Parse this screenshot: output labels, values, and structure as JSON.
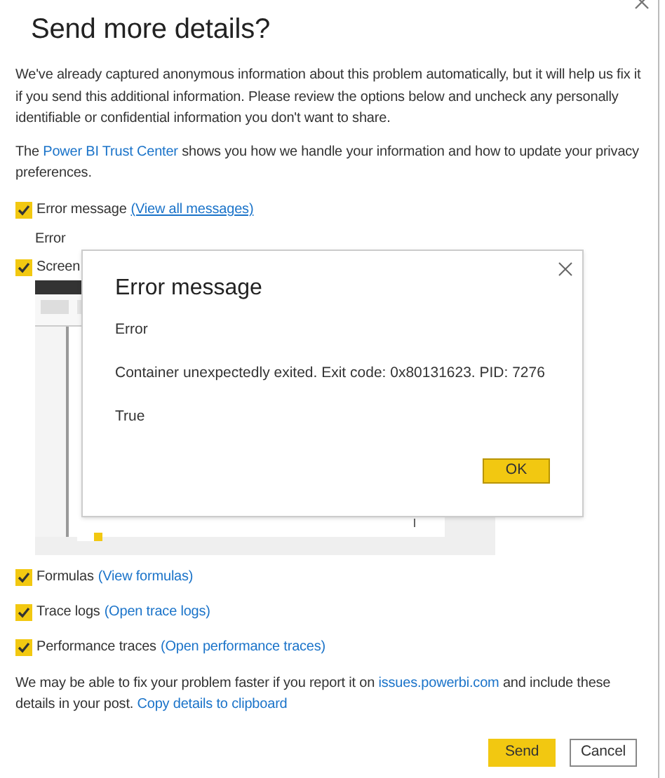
{
  "dialog": {
    "title": "Send more details?",
    "intro": "We've already captured anonymous information about this problem automatically, but it will help us fix it if you send this additional information. Please review the options below and uncheck any personally identifiable or confidential information you don't want to share.",
    "trust": {
      "before": "The ",
      "link": "Power BI Trust Center",
      "after": " shows you how we handle your information and how to update your privacy preferences."
    },
    "options": [
      {
        "kind": "detail",
        "label": "Error message",
        "link": "(View all messages)",
        "checked": true,
        "detail": "Error"
      },
      {
        "kind": "screenshot",
        "label": "Screen",
        "checked": true
      },
      {
        "kind": "plain",
        "label": "Formulas",
        "link": "(View formulas)",
        "checked": true
      },
      {
        "kind": "plain",
        "label": "Trace logs",
        "link": "(Open trace logs)",
        "checked": true
      },
      {
        "kind": "plain",
        "label": "Performance traces",
        "link": "(Open performance traces)",
        "checked": true
      }
    ],
    "footer": {
      "before": "We may be able to fix your problem faster if you report it on ",
      "link": "issues.powerbi.com",
      "middle": " and include these details in your post. ",
      "link2": "Copy details to clipboard"
    },
    "buttons": [
      {
        "label": "Send",
        "primary": true
      },
      {
        "label": "Cancel",
        "primary": false
      }
    ]
  },
  "error_popup": {
    "title": "Error message",
    "lines": [
      "Error",
      "Container unexpectedly exited. Exit code: 0x80131623. PID: 7276",
      "True"
    ],
    "button": "OK"
  }
}
